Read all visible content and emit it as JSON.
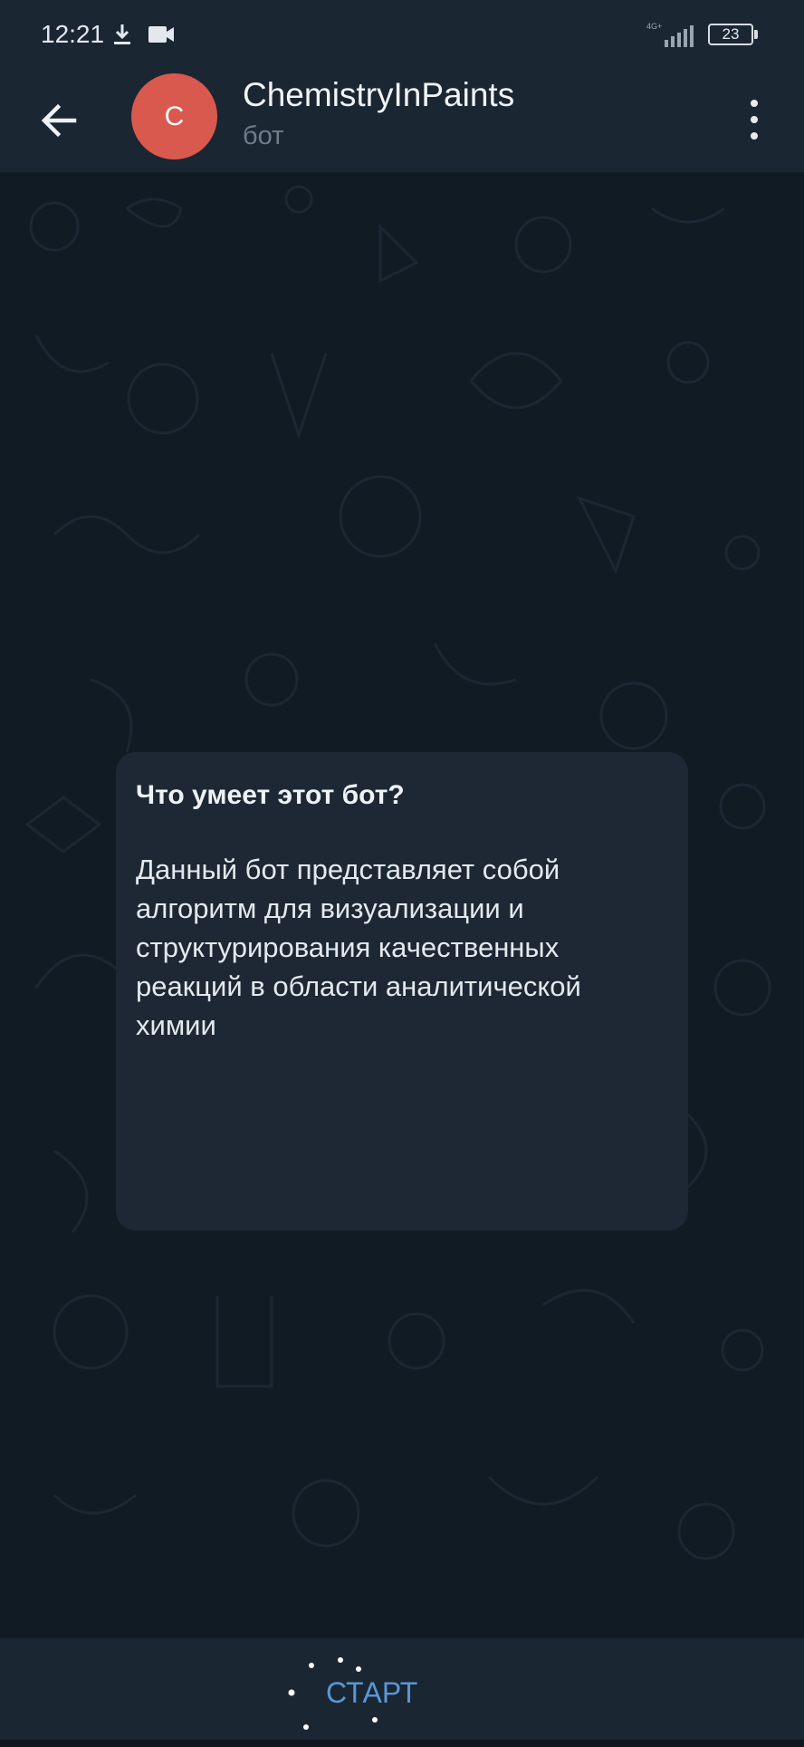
{
  "status_bar": {
    "time": "12:21",
    "network": "4G+",
    "battery": "23",
    "icons": [
      "download-icon",
      "video-icon",
      "signal-icon",
      "battery-icon"
    ]
  },
  "app_bar": {
    "avatar_letter": "C",
    "avatar_color": "#d9594f",
    "title": "ChemistryInPaints",
    "subtitle": "бот"
  },
  "message": {
    "title": "Что умеет этот бот?",
    "lines": [
      "Данный бот представляет собой",
      "алгоритм для визуализации и",
      "структурирования качественных",
      "реакций в области аналитической",
      "химии"
    ]
  },
  "bottom_bar": {
    "start_label": "СТАРТ",
    "accent": "#5a97d6"
  }
}
